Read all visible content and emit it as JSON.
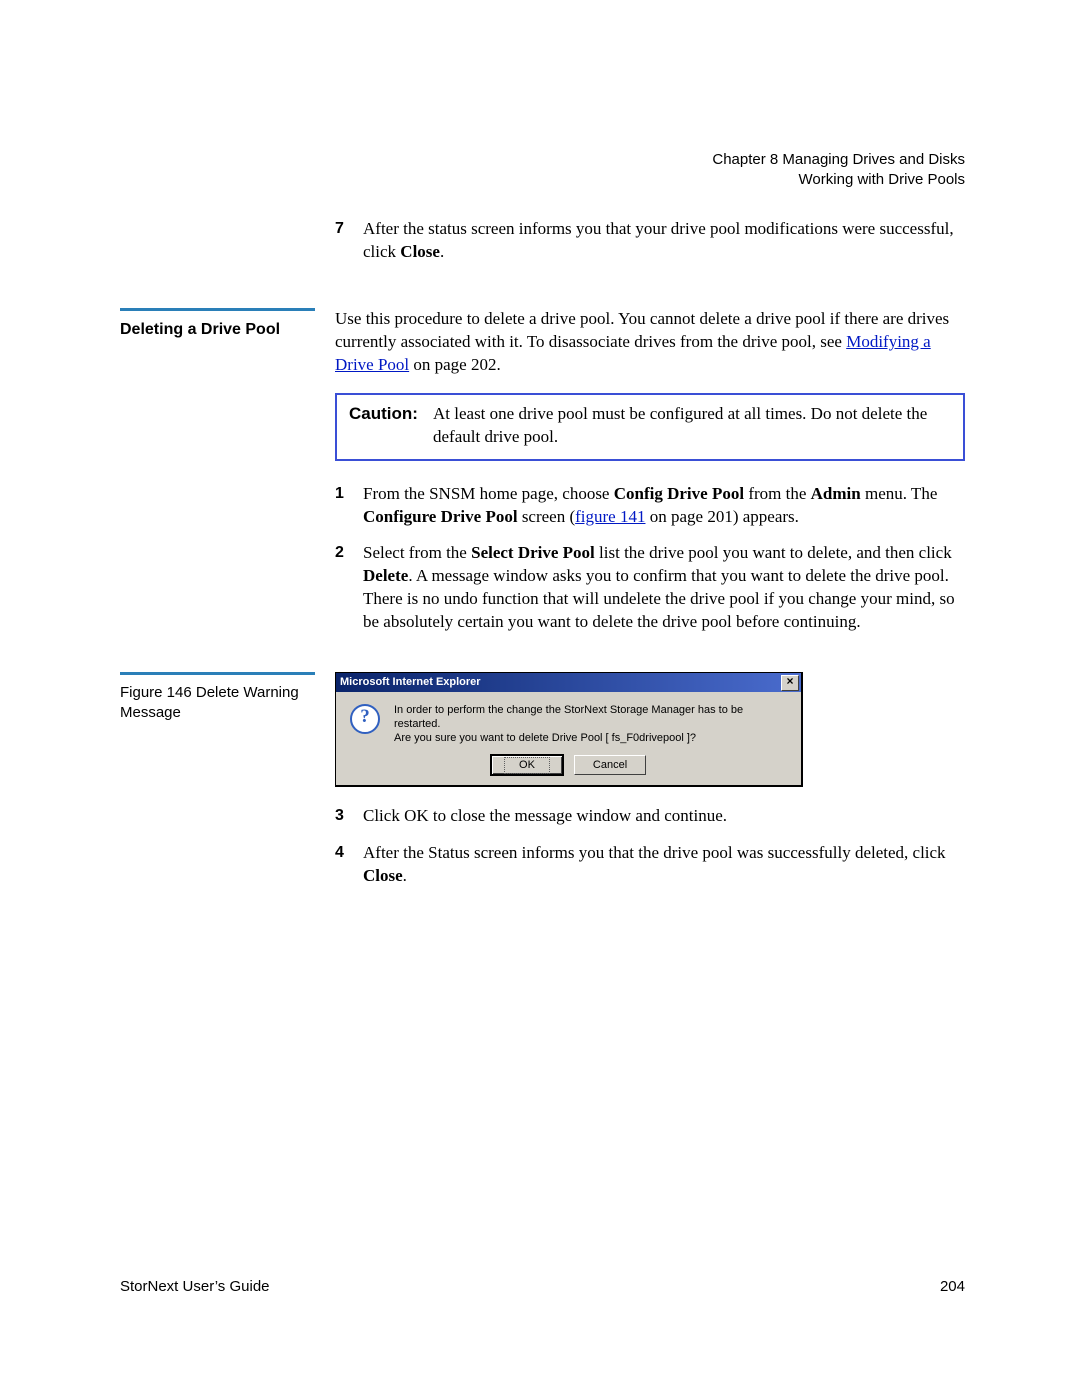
{
  "header": {
    "chapter": "Chapter 8  Managing Drives and Disks",
    "section": "Working with Drive Pools"
  },
  "step7": {
    "num": "7",
    "text_a": "After the status screen informs you that your drive pool modifications were successful, click ",
    "text_b": "Close",
    "text_c": "."
  },
  "sideHeading": "Deleting a Drive Pool",
  "intro": {
    "a": "Use this procedure to delete a drive pool. You cannot delete a drive pool if there are drives currently associated with it. To disassociate drives from the drive pool, see ",
    "link": "Modifying a Drive Pool",
    "b": " on page  202."
  },
  "caution": {
    "label": "Caution:",
    "text": "At least one drive pool must be configured at all times. Do not delete the default drive pool."
  },
  "step1": {
    "num": "1",
    "a": "From the SNSM home page, choose ",
    "b": "Config Drive Pool",
    "c": " from the ",
    "d": "Admin",
    "e": " menu. The ",
    "f": "Configure Drive Pool",
    "g": " screen (",
    "link": "figure 141",
    "h": " on page 201) appears."
  },
  "step2": {
    "num": "2",
    "a": "Select from the ",
    "b": "Select Drive Pool",
    "c": " list the drive pool you want to delete, and then click ",
    "d": "Delete",
    "e": ". A message window asks you to confirm that you want to delete the drive pool. There is no undo function that will undelete the drive pool if you change your mind, so be absolutely certain you want to delete the drive pool before continuing."
  },
  "figCaption": "Figure 146  Delete Warning Message",
  "dialog": {
    "title": "Microsoft Internet Explorer",
    "iconGlyph": "?",
    "line1": "In order to perform the change the StorNext Storage Manager has to be restarted.",
    "line2": "Are you sure you want to delete Drive Pool [ fs_F0drivepool ]?",
    "ok": "OK",
    "cancel": "Cancel",
    "closeGlyph": "×"
  },
  "step3": {
    "num": "3",
    "text": "Click OK to close the message window and continue."
  },
  "step4": {
    "num": "4",
    "a": "After the Status screen informs you that the drive pool was successfully deleted, click ",
    "b": "Close",
    "c": "."
  },
  "footer": {
    "left": "StorNext User’s Guide",
    "right": "204"
  }
}
